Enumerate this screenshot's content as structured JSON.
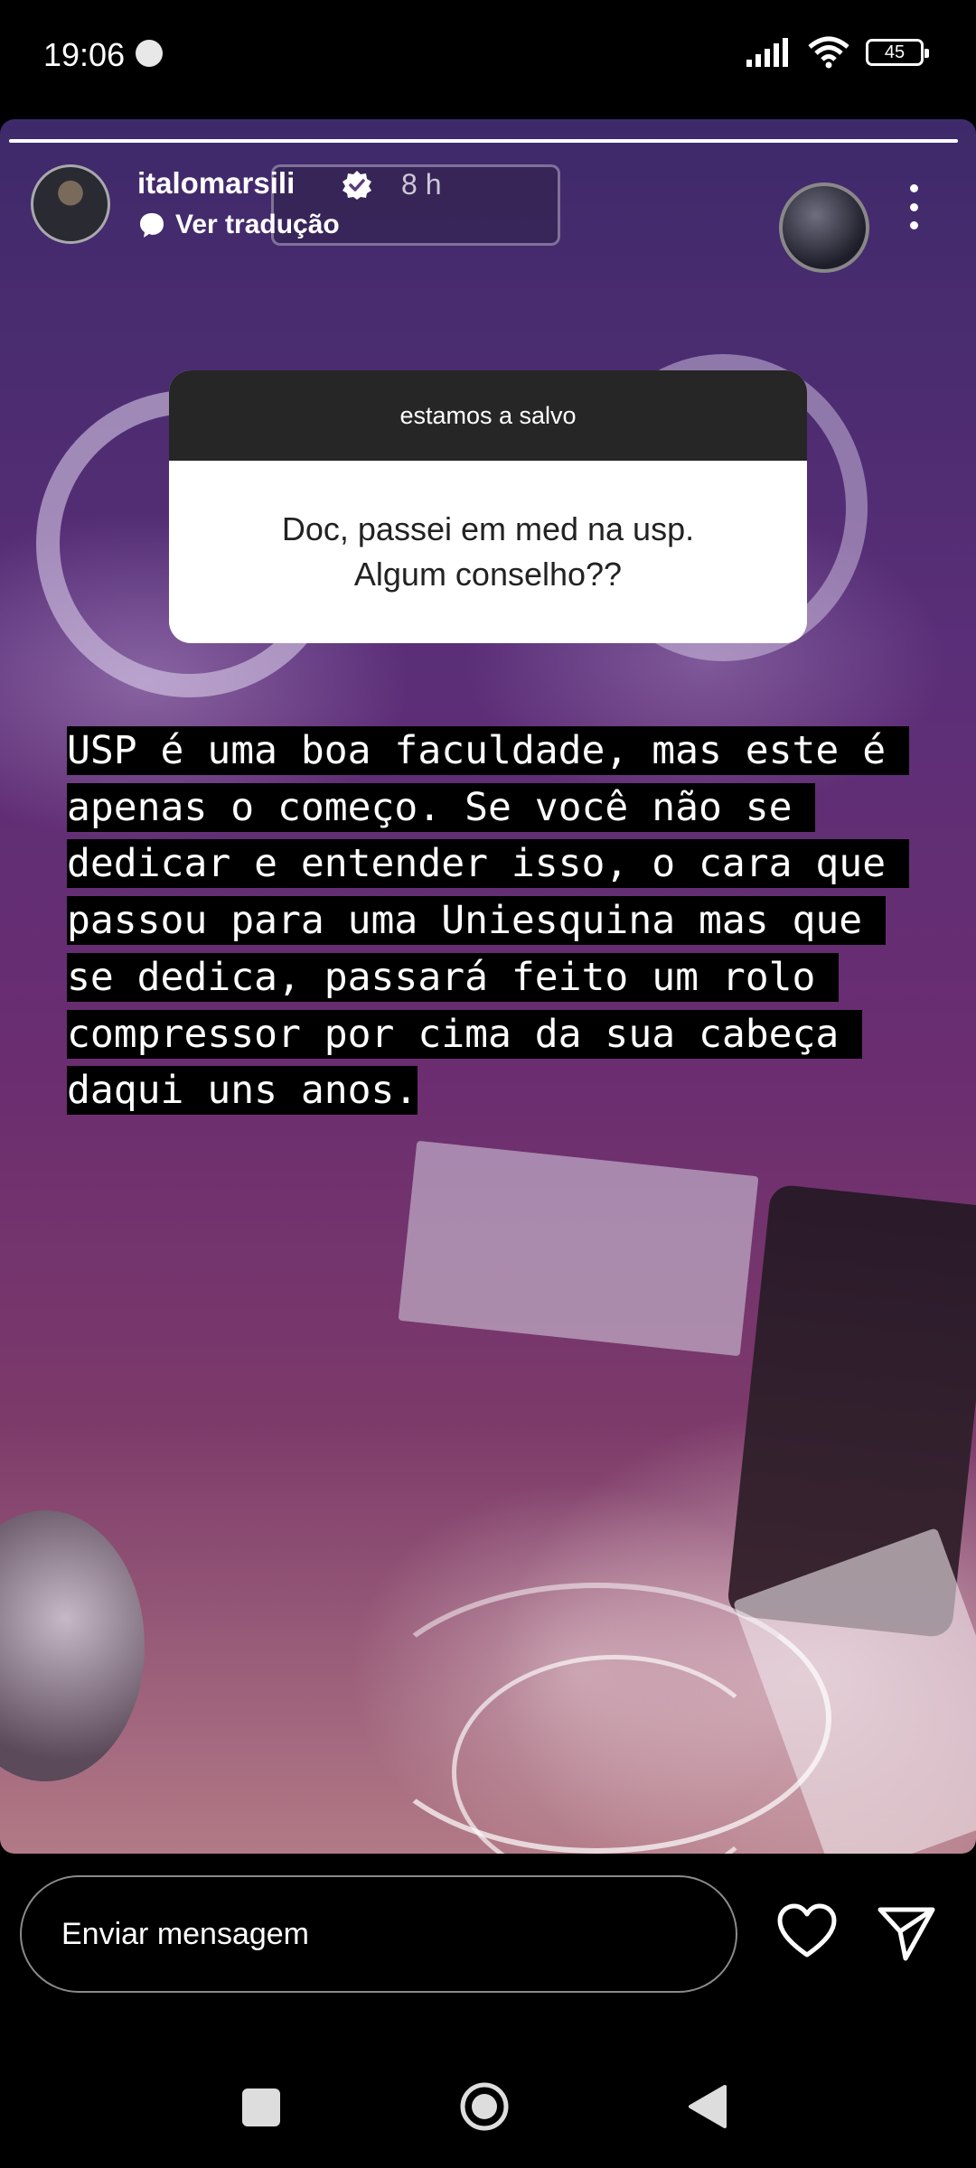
{
  "status_bar": {
    "time": "19:06",
    "app_icon": "burger-king-icon",
    "battery": "45",
    "icons": [
      "signal-icon",
      "wifi-icon",
      "battery-icon"
    ]
  },
  "story": {
    "progress": 1.0,
    "user": {
      "username": "italomarsili",
      "verified": true,
      "time_ago": "8 h",
      "translate_label": "Ver tradução"
    },
    "question_sticker": {
      "prompt": "estamos a salvo",
      "question": "Doc, passei em med na usp.\nAlgum conselho??"
    },
    "answer_text": "USP é uma boa faculdade, mas este é apenas o começo. Se você não se dedicar e entender isso, o cara que passou para uma Uniesquina mas que se dedica, passará feito um rolo compressor por cima da sua cabeça daqui uns anos."
  },
  "bottom_bar": {
    "message_placeholder": "Enviar mensagem",
    "icons": [
      "heart-icon",
      "send-icon"
    ]
  },
  "nav_bar": {
    "icons": [
      "recents-icon",
      "home-icon",
      "back-icon"
    ]
  },
  "colors": {
    "background": "#000000",
    "sticker_header": "#262626",
    "text_highlight": "#000000"
  }
}
